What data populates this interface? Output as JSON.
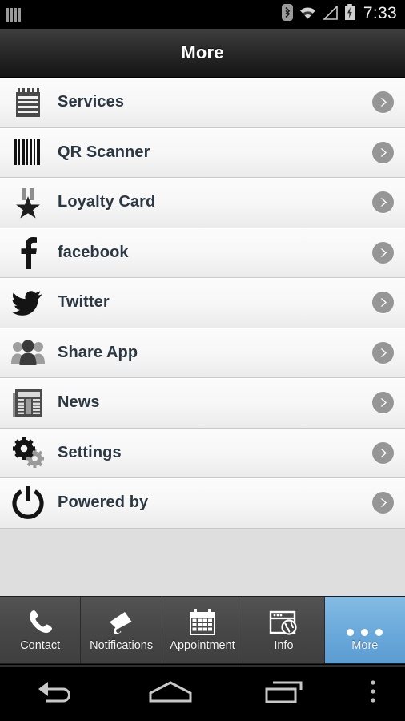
{
  "statusbar": {
    "time": "7:33",
    "icons": [
      "sim-bars-icon",
      "bluetooth-icon",
      "wifi-icon",
      "cell-signal-icon",
      "battery-charging-icon"
    ]
  },
  "titlebar": {
    "title": "More"
  },
  "list": {
    "items": [
      {
        "label": "Services",
        "icon": "notepad-icon"
      },
      {
        "label": "QR Scanner",
        "icon": "barcode-icon"
      },
      {
        "label": "Loyalty Card",
        "icon": "medal-star-icon"
      },
      {
        "label": "facebook",
        "icon": "facebook-icon"
      },
      {
        "label": "Twitter",
        "icon": "twitter-bird-icon"
      },
      {
        "label": "Share App",
        "icon": "people-group-icon"
      },
      {
        "label": "News",
        "icon": "newspaper-icon"
      },
      {
        "label": "Settings",
        "icon": "gears-icon"
      },
      {
        "label": "Powered by",
        "icon": "power-icon"
      }
    ],
    "chevron_icon": "chevron-right-icon"
  },
  "tabbar": {
    "active": "More",
    "accent_color": "#6aa9da",
    "tabs": [
      {
        "label": "Contact",
        "icon": "phone-icon"
      },
      {
        "label": "Notifications",
        "icon": "megaphone-icon"
      },
      {
        "label": "Appointment",
        "icon": "calendar-icon"
      },
      {
        "label": "Info",
        "icon": "browser-globe-icon"
      },
      {
        "label": "More",
        "icon": "ellipsis-icon"
      }
    ]
  },
  "navbar": {
    "buttons": [
      {
        "name": "back",
        "icon": "back-arrow-icon"
      },
      {
        "name": "home",
        "icon": "home-icon"
      },
      {
        "name": "recents",
        "icon": "recents-icon"
      },
      {
        "name": "menu",
        "icon": "overflow-menu-icon"
      }
    ]
  }
}
